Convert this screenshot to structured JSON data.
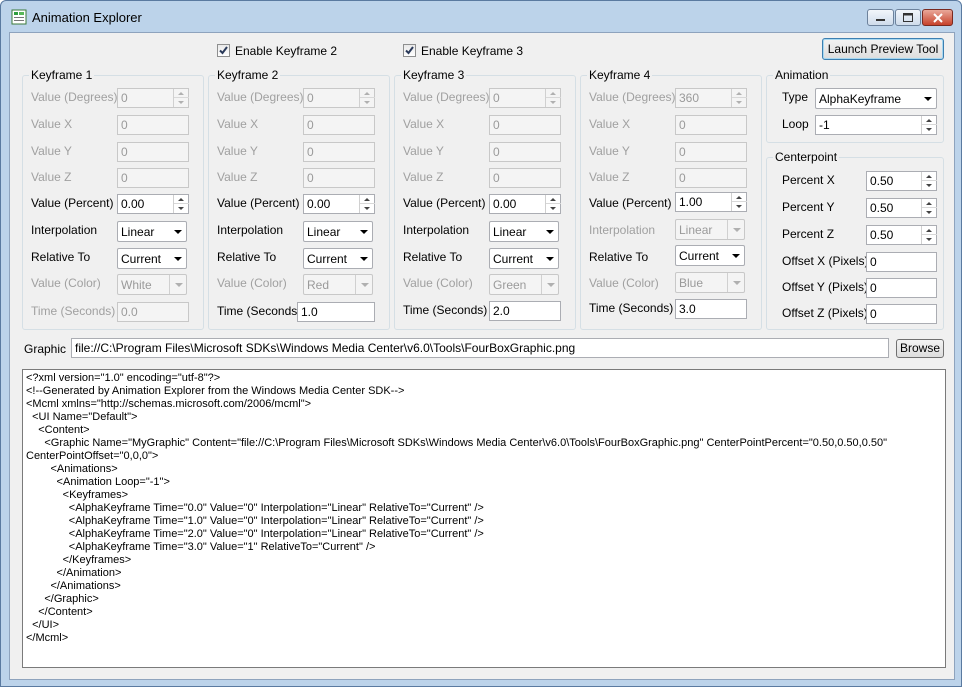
{
  "window": {
    "title": "Animation Explorer"
  },
  "toolbar": {
    "enable_kf2_label": "Enable Keyframe 2",
    "enable_kf3_label": "Enable Keyframe 3",
    "launch_label": "Launch Preview Tool"
  },
  "labels": {
    "value_degrees": "Value (Degrees)",
    "value_x": "Value X",
    "value_y": "Value Y",
    "value_z": "Value Z",
    "value_percent": "Value (Percent)",
    "interpolation": "Interpolation",
    "relative_to": "Relative To",
    "value_color": "Value (Color)",
    "time_seconds": "Time (Seconds)"
  },
  "keyframes": [
    {
      "title": "Keyframe 1",
      "degrees": "0",
      "x": "0",
      "y": "0",
      "z": "0",
      "percent": "0.00",
      "interpolation": "Linear",
      "relative_to": "Current",
      "color": "White",
      "time": "0.0"
    },
    {
      "title": "Keyframe 2",
      "degrees": "0",
      "x": "0",
      "y": "0",
      "z": "0",
      "percent": "0.00",
      "interpolation": "Linear",
      "relative_to": "Current",
      "color": "Red",
      "time": "1.0"
    },
    {
      "title": "Keyframe 3",
      "degrees": "0",
      "x": "0",
      "y": "0",
      "z": "0",
      "percent": "0.00",
      "interpolation": "Linear",
      "relative_to": "Current",
      "color": "Green",
      "time": "2.0"
    },
    {
      "title": "Keyframe 4",
      "degrees": "360",
      "x": "0",
      "y": "0",
      "z": "0",
      "percent": "1.00",
      "interpolation": "Linear",
      "relative_to": "Current",
      "color": "Blue",
      "time": "3.0"
    }
  ],
  "animation": {
    "title": "Animation",
    "type_label": "Type",
    "type_value": "AlphaKeyframe",
    "loop_label": "Loop",
    "loop_value": "-1"
  },
  "centerpoint": {
    "title": "Centerpoint",
    "percent_x_label": "Percent X",
    "percent_x": "0.50",
    "percent_y_label": "Percent Y",
    "percent_y": "0.50",
    "percent_z_label": "Percent Z",
    "percent_z": "0.50",
    "offset_x_label": "Offset X (Pixels)",
    "offset_x": "0",
    "offset_y_label": "Offset Y (Pixels)",
    "offset_y": "0",
    "offset_z_label": "Offset Z (Pixels)",
    "offset_z": "0"
  },
  "graphic": {
    "label": "Graphic",
    "path": "file://C:\\Program Files\\Microsoft SDKs\\Windows Media Center\\v6.0\\Tools\\FourBoxGraphic.png",
    "browse_label": "Browse"
  },
  "xml_lines": [
    "<?xml version=\"1.0\" encoding=\"utf-8\"?>",
    "<!--Generated by Animation Explorer from the Windows Media Center SDK-->",
    "<Mcml xmlns=\"http://schemas.microsoft.com/2006/mcml\">",
    "  <UI Name=\"Default\">",
    "    <Content>",
    "      <Graphic Name=\"MyGraphic\" Content=\"file://C:\\Program Files\\Microsoft SDKs\\Windows Media Center\\v6.0\\Tools\\FourBoxGraphic.png\" CenterPointPercent=\"0.50,0.50,0.50\"",
    "CenterPointOffset=\"0,0,0\">",
    "        <Animations>",
    "          <Animation Loop=\"-1\">",
    "            <Keyframes>",
    "              <AlphaKeyframe Time=\"0.0\" Value=\"0\" Interpolation=\"Linear\" RelativeTo=\"Current\" />",
    "              <AlphaKeyframe Time=\"1.0\" Value=\"0\" Interpolation=\"Linear\" RelativeTo=\"Current\" />",
    "              <AlphaKeyframe Time=\"2.0\" Value=\"0\" Interpolation=\"Linear\" RelativeTo=\"Current\" />",
    "              <AlphaKeyframe Time=\"3.0\" Value=\"1\" RelativeTo=\"Current\" />",
    "            </Keyframes>",
    "          </Animation>",
    "        </Animations>",
    "      </Graphic>",
    "    </Content>",
    "  </UI>",
    "</Mcml>"
  ],
  "colors": {
    "title_bar": "#bcd3ea",
    "close_button": "#c7422b",
    "client_bg": "#f0f0f0",
    "disabled_text": "#a0a0a0"
  }
}
